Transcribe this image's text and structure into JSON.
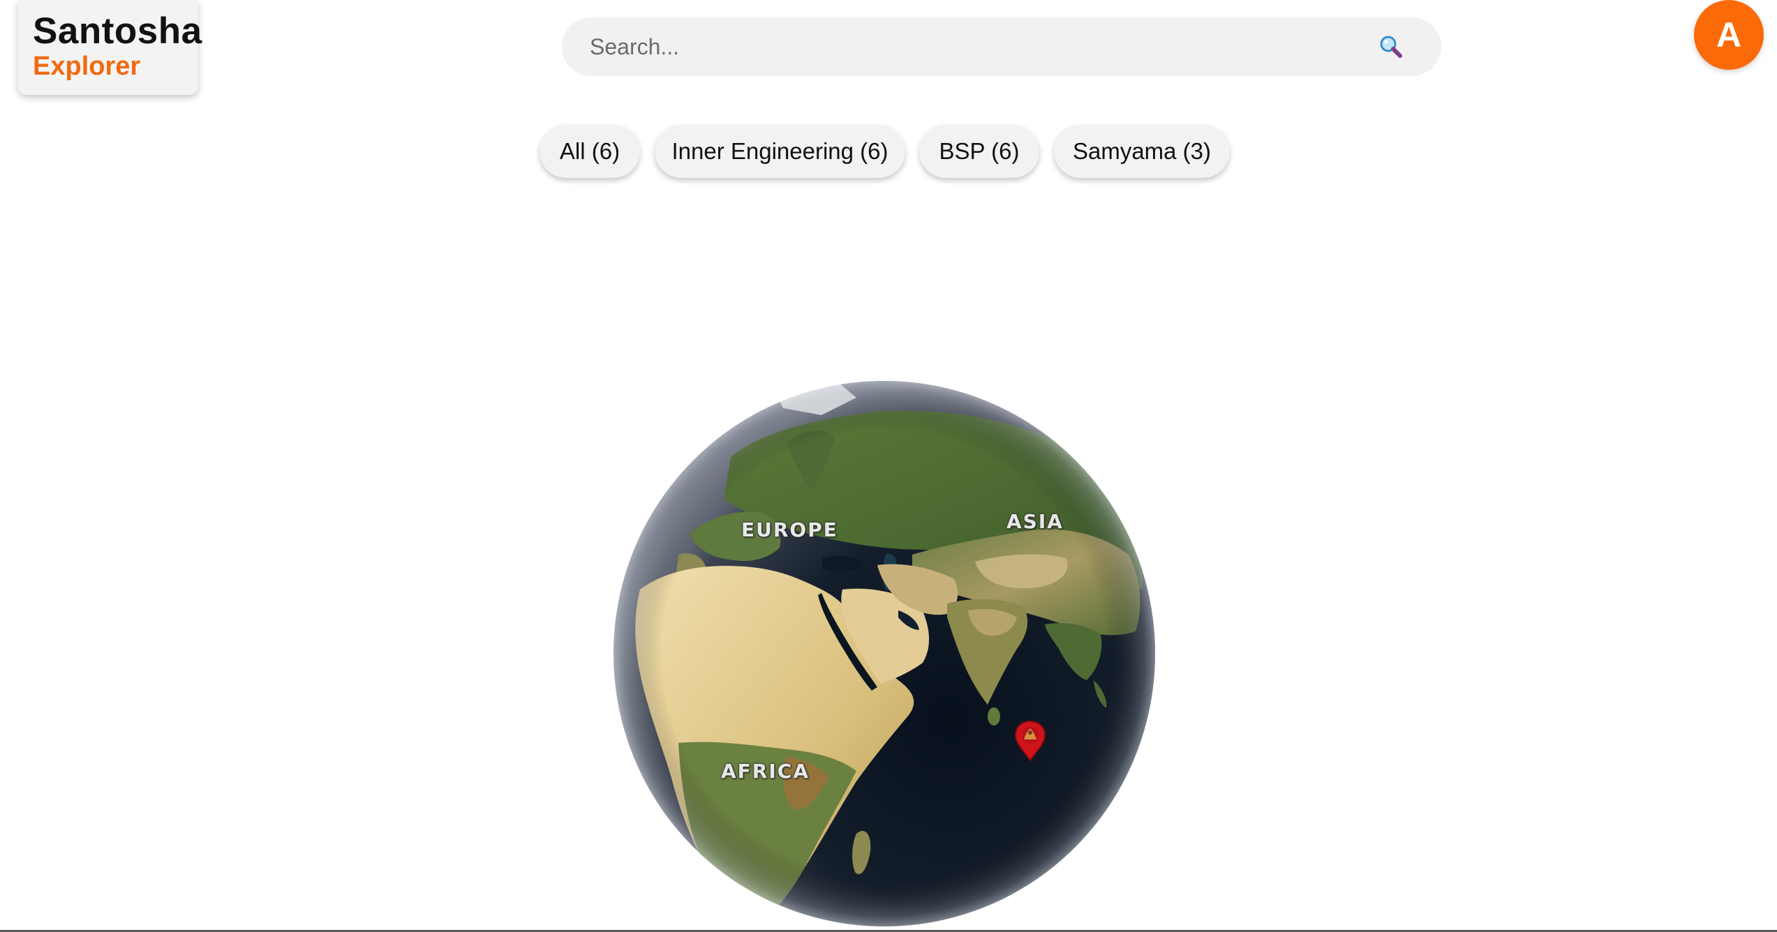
{
  "logo": {
    "line1": "Santosha",
    "line2": "Explorer"
  },
  "search": {
    "placeholder": "Search...",
    "value": "",
    "icon": "search-icon"
  },
  "user": {
    "avatar_initial": "A"
  },
  "filters": [
    {
      "label": "All (6)"
    },
    {
      "label": "Inner Engineering (6)"
    },
    {
      "label": "BSP (6)"
    },
    {
      "label": "Samyama (3)"
    }
  ],
  "map": {
    "labels": {
      "europe": "EUROPE",
      "asia": "ASIA",
      "africa": "AFRICA"
    },
    "markers": [
      {
        "icon": "map-pin-icon",
        "color": "#d0141c"
      }
    ]
  },
  "colors": {
    "accent": "#f26a0f",
    "avatar": "#fb6a08",
    "marker": "#d0141c"
  }
}
